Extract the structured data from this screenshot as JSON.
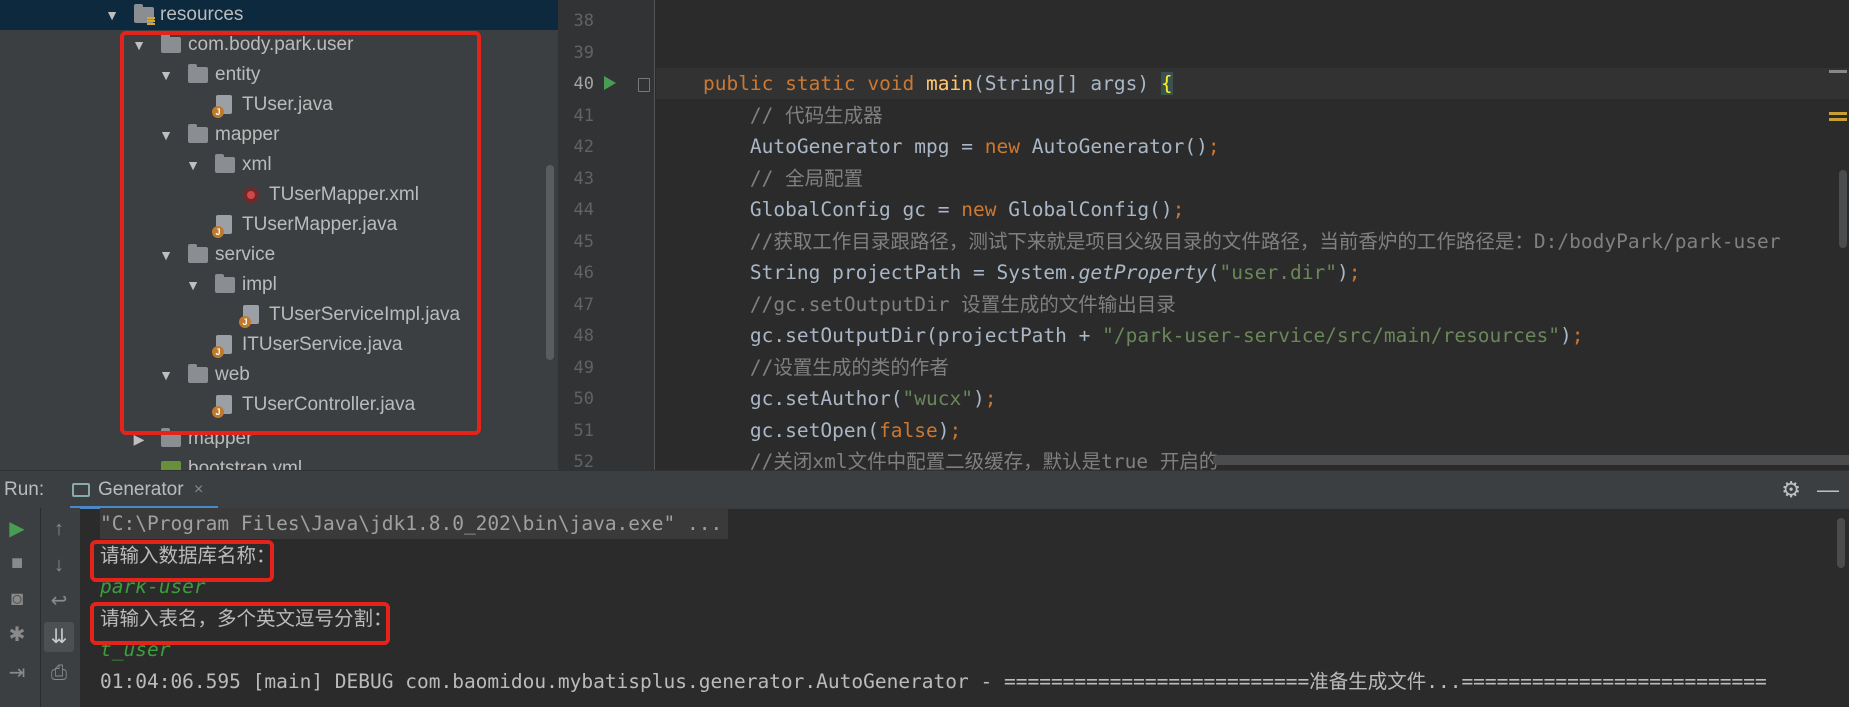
{
  "project_tree": {
    "items": [
      {
        "label": "resources",
        "icon": "resources-folder-icon",
        "expanded": true
      },
      {
        "label": "com.body.park.user",
        "icon": "package-folder-icon",
        "expanded": true
      },
      {
        "label": "entity",
        "icon": "folder-icon",
        "expanded": true
      },
      {
        "label": "TUser.java",
        "icon": "java-class-icon"
      },
      {
        "label": "mapper",
        "icon": "folder-icon",
        "expanded": true
      },
      {
        "label": "xml",
        "icon": "folder-icon",
        "expanded": true
      },
      {
        "label": "TUserMapper.xml",
        "icon": "mybatis-xml-icon"
      },
      {
        "label": "TUserMapper.java",
        "icon": "java-class-icon"
      },
      {
        "label": "service",
        "icon": "folder-icon",
        "expanded": true
      },
      {
        "label": "impl",
        "icon": "folder-icon",
        "expanded": true
      },
      {
        "label": "TUserServiceImpl.java",
        "icon": "java-class-icon"
      },
      {
        "label": "ITUserService.java",
        "icon": "java-class-icon"
      },
      {
        "label": "web",
        "icon": "folder-icon",
        "expanded": true
      },
      {
        "label": "TUserController.java",
        "icon": "java-class-icon"
      },
      {
        "label": "mapper",
        "icon": "folder-icon",
        "expanded": false
      },
      {
        "label": "bootstrap.yml",
        "icon": "yaml-file-icon"
      }
    ]
  },
  "editor": {
    "line_numbers": [
      "38",
      "39",
      "40",
      "41",
      "42",
      "43",
      "44",
      "45",
      "46",
      "47",
      "48",
      "49",
      "50",
      "51",
      "52"
    ],
    "current_line": "40",
    "lines": {
      "l40": {
        "kw1": "public static void ",
        "fn": "main",
        "rest": "(String[] args) ",
        "brace": "{"
      },
      "l41": {
        "comment": "// 代码生成器"
      },
      "l42": {
        "a": "AutoGenerator mpg = ",
        "kw": "new",
        "b": " AutoGenerator()",
        "semi": ";"
      },
      "l43": {
        "comment": "// 全局配置"
      },
      "l44": {
        "a": "GlobalConfig gc = ",
        "kw": "new",
        "b": " GlobalConfig()",
        "semi": ";"
      },
      "l45": {
        "comment": "//获取工作目录跟路径，测试下来就是项目父级目录的文件路径，当前香炉的工作路径是：D:/bodyPark/park-user"
      },
      "l46": {
        "a": "String projectPath = System.",
        "it": "getProperty",
        "b": "(",
        "str": "\"user.dir\"",
        "c": ")",
        "semi": ";"
      },
      "l47": {
        "comment": "//gc.setOutputDir 设置生成的文件输出目录"
      },
      "l48": {
        "a": "gc.setOutputDir(projectPath + ",
        "str": "\"/park-user-service/src/main/resources\"",
        "c": ")",
        "semi": ";"
      },
      "l49": {
        "comment": "//设置生成的类的作者"
      },
      "l50": {
        "a": "gc.setAuthor(",
        "str": "\"wucx\"",
        "c": ")",
        "semi": ";"
      },
      "l51": {
        "a": "gc.setOpen(",
        "kw": "false",
        "c": ")",
        "semi": ";"
      },
      "l52": {
        "comment": "//关闭xml文件中配置二级缓存，默认是true 开启的"
      }
    }
  },
  "run_panel": {
    "label": "Run:",
    "tab_label": "Generator",
    "tab_close": "×",
    "settings_icon": "gear-icon",
    "minimize_icon": "minimize-icon",
    "console": [
      "\"C:\\Program Files\\Java\\jdk1.8.0_202\\bin\\java.exe\" ...",
      "请输入数据库名称：",
      "park-user",
      "请输入表名，多个英文逗号分割：",
      "t_user",
      "01:04:06.595 [main] DEBUG com.baomidou.mybatisplus.generator.AutoGenerator - ==========================准备生成文件...=========================="
    ]
  },
  "colors": {
    "highlight_box": "#e4241b",
    "keyword": "#cc7832",
    "string": "#6a8759",
    "comment": "#808080",
    "user_input": "#3a9e3a"
  }
}
